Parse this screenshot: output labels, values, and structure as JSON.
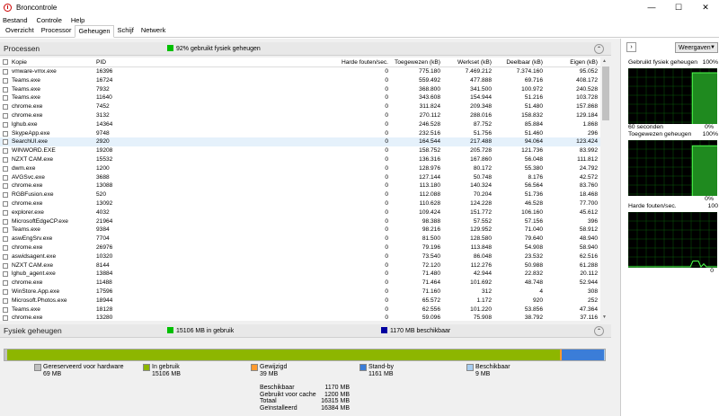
{
  "window": {
    "title": "Broncontrole",
    "minimize": "—",
    "maximize": "☐",
    "close": "✕"
  },
  "menu": [
    "Bestand",
    "Controle",
    "Help"
  ],
  "tabs": [
    {
      "label": "Overzicht",
      "active": false
    },
    {
      "label": "Processor",
      "active": false
    },
    {
      "label": "Geheugen",
      "active": true
    },
    {
      "label": "Schijf",
      "active": false
    },
    {
      "label": "Netwerk",
      "active": false
    }
  ],
  "processes": {
    "title": "Processen",
    "status": "92% gebruikt fysiek geheugen",
    "status_color": "#00c000",
    "columns": [
      "Kopie",
      "PID",
      "Harde fouten/sec.",
      "Toegewezen (kB)",
      "Werkset (kB)",
      "Deelbaar (kB)",
      "Eigen (kB)"
    ],
    "rows": [
      [
        "vmware-vmx.exe",
        "16396",
        "0",
        "775.180",
        "7.469.212",
        "7.374.160",
        "95.052"
      ],
      [
        "Teams.exe",
        "16724",
        "0",
        "559.492",
        "477.888",
        "69.716",
        "408.172"
      ],
      [
        "Teams.exe",
        "7932",
        "0",
        "368.800",
        "341.500",
        "100.972",
        "240.528"
      ],
      [
        "Teams.exe",
        "11640",
        "0",
        "343.608",
        "154.944",
        "51.216",
        "103.728"
      ],
      [
        "chrome.exe",
        "7452",
        "0",
        "311.824",
        "209.348",
        "51.480",
        "157.868"
      ],
      [
        "chrome.exe",
        "3132",
        "0",
        "270.112",
        "288.016",
        "158.832",
        "129.184"
      ],
      [
        "lghub.exe",
        "14364",
        "0",
        "246.528",
        "87.752",
        "85.884",
        "1.868"
      ],
      [
        "SkypeApp.exe",
        "9748",
        "0",
        "232.516",
        "51.756",
        "51.460",
        "296"
      ],
      [
        "SearchUI.exe",
        "2920",
        "0",
        "164.544",
        "217.488",
        "94.064",
        "123.424"
      ],
      [
        "WINWORD.EXE",
        "19208",
        "0",
        "158.752",
        "205.728",
        "121.736",
        "83.992"
      ],
      [
        "NZXT CAM.exe",
        "15532",
        "0",
        "136.316",
        "167.860",
        "56.048",
        "111.812"
      ],
      [
        "dwm.exe",
        "1200",
        "0",
        "128.976",
        "80.172",
        "55.380",
        "24.792"
      ],
      [
        "AVGSvc.exe",
        "3688",
        "0",
        "127.144",
        "50.748",
        "8.176",
        "42.572"
      ],
      [
        "chrome.exe",
        "13088",
        "0",
        "113.180",
        "140.324",
        "56.564",
        "83.760"
      ],
      [
        "RGBFusion.exe",
        "520",
        "0",
        "112.088",
        "70.204",
        "51.736",
        "18.468"
      ],
      [
        "chrome.exe",
        "13092",
        "0",
        "110.628",
        "124.228",
        "46.528",
        "77.700"
      ],
      [
        "explorer.exe",
        "4032",
        "0",
        "109.424",
        "151.772",
        "106.160",
        "45.612"
      ],
      [
        "MicrosoftEdgeCP.exe",
        "21964",
        "0",
        "98.388",
        "57.552",
        "57.156",
        "396"
      ],
      [
        "Teams.exe",
        "9384",
        "0",
        "98.216",
        "129.952",
        "71.040",
        "58.912"
      ],
      [
        "aswEngSrv.exe",
        "7704",
        "0",
        "81.500",
        "128.580",
        "79.640",
        "48.940"
      ],
      [
        "chrome.exe",
        "26976",
        "0",
        "79.196",
        "113.848",
        "54.908",
        "58.940"
      ],
      [
        "aswidsagent.exe",
        "10320",
        "0",
        "73.540",
        "86.048",
        "23.532",
        "62.516"
      ],
      [
        "NZXT CAM.exe",
        "8144",
        "0",
        "72.120",
        "112.276",
        "50.988",
        "61.288"
      ],
      [
        "lghub_agent.exe",
        "13884",
        "0",
        "71.480",
        "42.944",
        "22.832",
        "20.112"
      ],
      [
        "chrome.exe",
        "11488",
        "0",
        "71.464",
        "101.692",
        "48.748",
        "52.944"
      ],
      [
        "WinStore.App.exe",
        "17596",
        "0",
        "71.160",
        "312",
        "4",
        "308"
      ],
      [
        "Microsoft.Photos.exe",
        "18944",
        "0",
        "65.572",
        "1.172",
        "920",
        "252"
      ],
      [
        "Teams.exe",
        "18128",
        "0",
        "62.556",
        "101.220",
        "53.856",
        "47.364"
      ],
      [
        "chrome.exe",
        "13280",
        "0",
        "59.096",
        "75.908",
        "38.792",
        "37.116"
      ]
    ],
    "highlight_row": 8
  },
  "physical": {
    "title": "Fysiek geheugen",
    "in_use_badge": "15106 MB in gebruik",
    "in_use_color": "#00c000",
    "available_badge": "1170 MB beschikbaar",
    "available_color": "#0000a0",
    "segments": [
      {
        "label": "Gereserveerd voor hardware",
        "value": "69 MB",
        "color": "#c0c0c0",
        "mb": 69
      },
      {
        "label": "In gebruik",
        "value": "15106 MB",
        "color": "#8db600",
        "mb": 15106
      },
      {
        "label": "Gewijzigd",
        "value": "39 MB",
        "color": "#ff9a2e",
        "mb": 39
      },
      {
        "label": "Stand-by",
        "value": "1161 MB",
        "color": "#3b7dd8",
        "mb": 1161
      },
      {
        "label": "Beschikbaar",
        "value": "9 MB",
        "color": "#a7cdf0",
        "mb": 9
      }
    ],
    "stats": [
      {
        "label": "Beschikbaar",
        "value": "1170 MB"
      },
      {
        "label": "Gebruikt voor cache",
        "value": "1200 MB"
      },
      {
        "label": "Totaal",
        "value": "16315 MB"
      },
      {
        "label": "Geïnstalleerd",
        "value": "16384 MB"
      }
    ]
  },
  "side": {
    "view_label": "Weergaven",
    "graphs": [
      {
        "label": "Gebruikt fysiek geheugen",
        "max": "100%",
        "foot_left": "60 seconden",
        "foot_right": "0%",
        "level": 0.92
      },
      {
        "label": "Toegewezen geheugen",
        "max": "100%",
        "foot_left": "",
        "foot_right": "0%",
        "level": 0.9
      },
      {
        "label": "Harde fouten/sec.",
        "max": "100",
        "foot_left": "",
        "foot_right": "0",
        "level": 0.02
      }
    ]
  }
}
